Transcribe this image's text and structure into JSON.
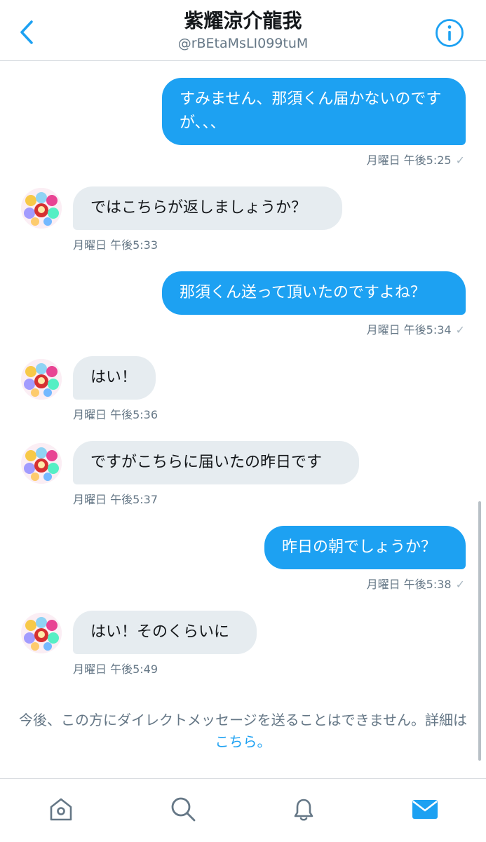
{
  "header": {
    "title": "紫耀涼介龍我",
    "handle": "@rBEtaMsLI099tuM"
  },
  "messages": [
    {
      "direction": "sent",
      "text": "すみません、那須くん届かないのですが、、、",
      "time": "月曜日 午後5:25"
    },
    {
      "direction": "received",
      "text": "ではこちらが返しましょうか？",
      "time": "月曜日 午後5:33"
    },
    {
      "direction": "sent",
      "text": "那須くん送って頂いたのですよね？",
      "time": "月曜日 午後5:34"
    },
    {
      "direction": "received",
      "text": "はい！",
      "time": "月曜日 午後5:36"
    },
    {
      "direction": "received",
      "text": "ですがこちらに届いたの昨日です",
      "time": "月曜日 午後5:37"
    },
    {
      "direction": "sent",
      "text": "昨日の朝でしょうか？",
      "time": "月曜日 午後5:38"
    },
    {
      "direction": "received",
      "text": "はい！そのくらいに",
      "time": "月曜日 午後5:49"
    }
  ],
  "read_mark": "✓",
  "notice": {
    "text": "今後、この方にダイレクトメッセージを送ることはできません。詳細は ",
    "link": "こちら。"
  },
  "icons": {
    "back": "chevron-left-icon",
    "info": "info-icon",
    "tabs": [
      "home-icon",
      "search-icon",
      "notifications-icon",
      "messages-icon"
    ]
  },
  "colors": {
    "accent": "#1da1f2",
    "received_bubble": "#e6ecf0",
    "meta_text": "#657786"
  }
}
